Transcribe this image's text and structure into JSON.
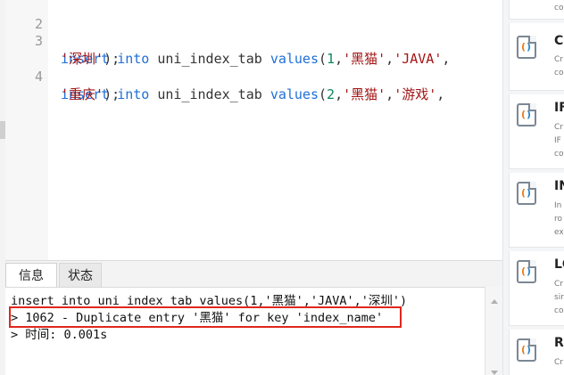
{
  "editor": {
    "lines": [
      {
        "number": "2",
        "text": ""
      },
      {
        "number": "3",
        "kw1": "insert",
        "kw2": "into",
        "table": "uni_index_tab",
        "fn": "values",
        "num": "1",
        "s1": "'黑猫'",
        "s2": "'JAVA'",
        "s3": "'深圳'"
      },
      {
        "number": "4",
        "kw1": "insert",
        "kw2": "into",
        "table": "uni_index_tab",
        "fn": "values",
        "num": "2",
        "s1": "'黑猫'",
        "s2": "'游戏'",
        "s3": "'重庆'"
      }
    ]
  },
  "tabs": [
    {
      "label": "信息",
      "active": true
    },
    {
      "label": "状态",
      "active": false
    }
  ],
  "output": {
    "lines": [
      "insert into uni_index_tab values(1,'黑猫','JAVA','深圳')",
      "> 1062 - Duplicate entry '黑猫' for key 'index_name'",
      "> 时间: 0.001s"
    ],
    "highlight_color": "#e0271d"
  },
  "sidebar": {
    "cards": [
      {
        "title": "",
        "desc": [
          "co"
        ]
      },
      {
        "title": "C",
        "desc": [
          "Cr",
          "co"
        ]
      },
      {
        "title": "IF",
        "desc": [
          "Cr",
          "IF",
          "co"
        ]
      },
      {
        "title": "IN",
        "desc": [
          "In",
          "ro",
          "ex"
        ]
      },
      {
        "title": "LC",
        "desc": [
          "Cr",
          "sir",
          "co"
        ]
      },
      {
        "title": "R",
        "desc": [
          "Cr"
        ]
      }
    ]
  }
}
